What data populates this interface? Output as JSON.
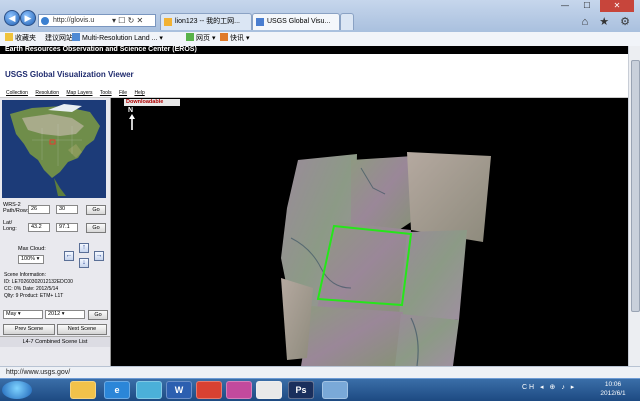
{
  "browser": {
    "address": "http://glovis.u",
    "address_buttons": "▾ ☐ ↻ ✕",
    "tabs": [
      {
        "label": "lion123 -- 我的工网..."
      },
      {
        "label": "USGS Global Visu..."
      }
    ],
    "window_controls": {
      "minimize": "—",
      "maximize": "☐",
      "close": "✕"
    },
    "right_icons": "⌂ ★ ⚙"
  },
  "favorites": {
    "items": [
      {
        "label": "收藏夹"
      },
      {
        "label": "建议网站 ▾"
      },
      {
        "label": "Multi-Resolution Land ... ▾"
      },
      {
        "label": "网页 ▾"
      },
      {
        "label": "快讯 ▾"
      }
    ]
  },
  "page": {
    "eros_header": "Earth Resources Observation and Science Center (EROS)",
    "title": "USGS Global Visualization Viewer",
    "menu": [
      "Collection",
      "Resolution",
      "Map Layers",
      "Tools",
      "File",
      "Help"
    ]
  },
  "panel": {
    "wrs_label": "WRS-2\nPath/Row:",
    "path": "26",
    "row": "30",
    "go": "Go",
    "latlong_label": "Lat/\nLong:",
    "lat": "43.2",
    "long": "97.1",
    "go2": "Go",
    "max_cloud_label": "Max Cloud:",
    "max_cloud": "100% ▾",
    "arrows": {
      "up": "↑",
      "down": "↓",
      "left": "←",
      "right": "→"
    },
    "scene_info_title": "Scene Information:",
    "scene_lines": [
      "ID: LE70260302012132EDC00",
      "CC: 0%   Date: 2012/5/14",
      "Qlty: 9  Product: ETM+ L1T"
    ],
    "month": "May ▾",
    "year": "2012 ▾",
    "prev_scene": "Prev Scene",
    "next_scene": "Next Scene",
    "scene_list": "L4-7 Combined Scene List"
  },
  "map": {
    "downloadable": "Downloadable",
    "north": "N"
  },
  "status_url": "http://www.usgs.gov/",
  "taskbar": {
    "apps": [
      "",
      "e",
      "",
      "W",
      "",
      "",
      "",
      "",
      "Ps",
      ""
    ],
    "tray": "CH ◂ ⊕ ♪ ▸",
    "time": "10:06",
    "date": "2012/6/1"
  }
}
